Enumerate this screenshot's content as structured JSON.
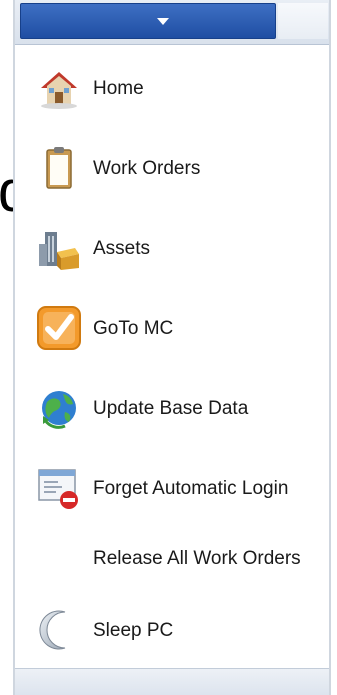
{
  "background_text": "d",
  "colors": {
    "accent": "#2a5bb2",
    "panel_border": "#cfd6df"
  },
  "menu": {
    "items": [
      {
        "label": "Home",
        "icon": "house-icon"
      },
      {
        "label": "Work Orders",
        "icon": "clipboard-icon"
      },
      {
        "label": "Assets",
        "icon": "building-icon"
      },
      {
        "label": "GoTo MC",
        "icon": "checkmark-icon"
      },
      {
        "label": "Update Base Data",
        "icon": "globe-refresh-icon"
      },
      {
        "label": "Forget Automatic Login",
        "icon": "window-remove-icon"
      },
      {
        "label": "Release All Work Orders",
        "icon": ""
      },
      {
        "label": "Sleep PC",
        "icon": "moon-icon"
      }
    ]
  }
}
